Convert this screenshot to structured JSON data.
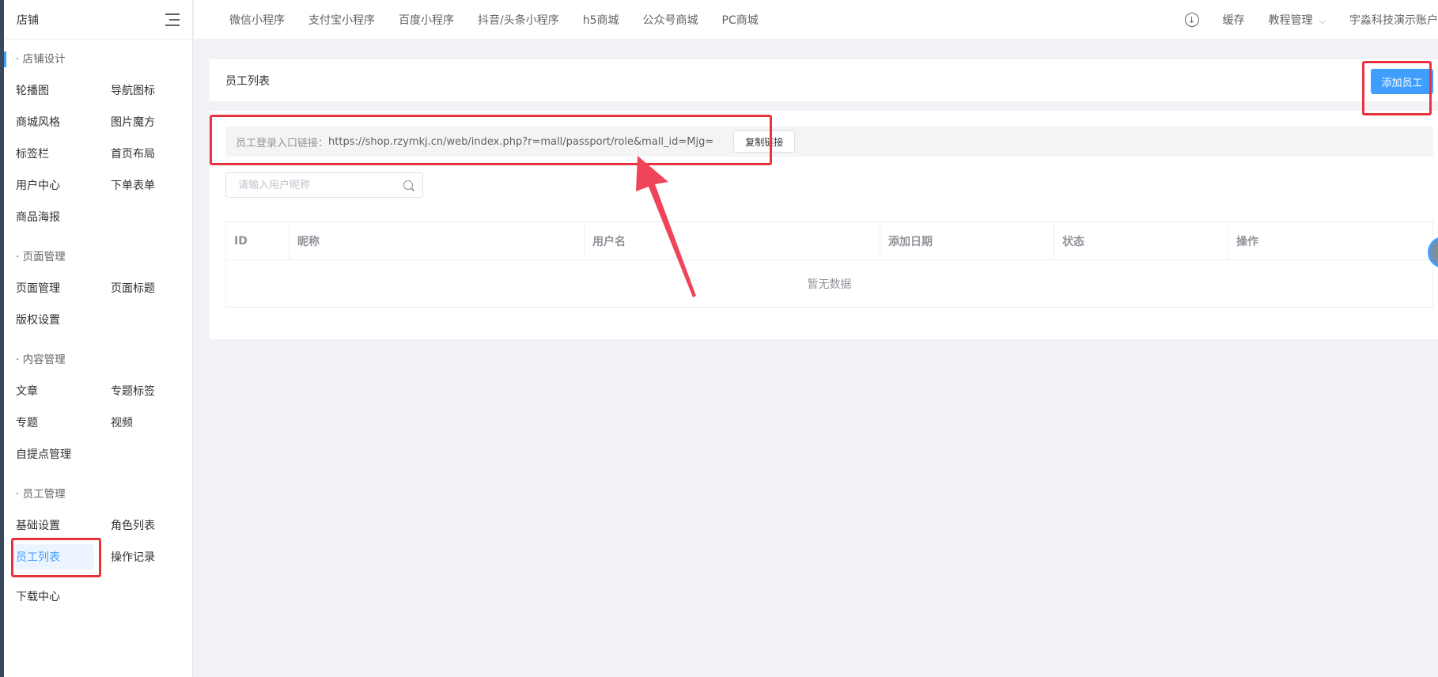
{
  "sidebar": {
    "title": "店铺",
    "groups": [
      {
        "title": "· 店铺设计",
        "items": [
          "轮播图",
          "导航图标",
          "商城风格",
          "图片魔方",
          "标签栏",
          "首页布局",
          "用户中心",
          "下单表单",
          "商品海报"
        ]
      },
      {
        "title": "· 页面管理",
        "items": [
          "页面管理",
          "页面标题",
          "版权设置"
        ]
      },
      {
        "title": "· 内容管理",
        "items": [
          "文章",
          "专题标签",
          "专题",
          "视频",
          "自提点管理"
        ]
      },
      {
        "title": "· 员工管理",
        "items": [
          "基础设置",
          "角色列表",
          "员工列表",
          "操作记录"
        ]
      }
    ],
    "footer_item": "下载中心",
    "active_item": "员工列表"
  },
  "topbar": {
    "nav": [
      "微信小程序",
      "支付宝小程序",
      "百度小程序",
      "抖音/头条小程序",
      "h5商城",
      "公众号商城",
      "PC商城"
    ],
    "cache": "缓存",
    "tutorial": "教程管理",
    "account": "宇淼科技演示账户"
  },
  "page": {
    "title": "员工列表",
    "add_button": "添加员工",
    "link_label": "员工登录入口链接：",
    "link_url": "https://shop.rzymkj.cn/web/index.php?r=mall/passport/role&mall_id=Mjg=",
    "copy_button": "复制链接",
    "search_placeholder": "请输入用户昵称",
    "table": {
      "columns": [
        "ID",
        "昵称",
        "用户名",
        "添加日期",
        "状态",
        "操作"
      ],
      "empty_text": "暂无数据"
    }
  },
  "colors": {
    "primary": "#409eff",
    "highlight": "#e8333c",
    "arrow": "#f0445a"
  }
}
